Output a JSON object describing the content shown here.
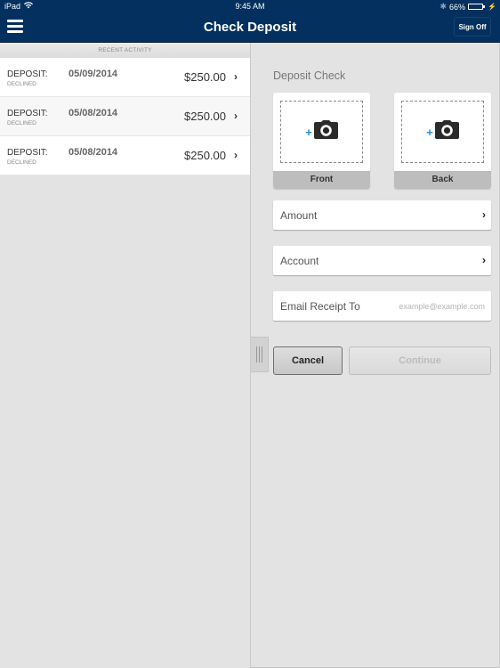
{
  "status_bar": {
    "device": "iPad",
    "time": "9:45 AM",
    "battery_percent": "66%",
    "battery_level": 0.66
  },
  "navbar": {
    "title": "Check Deposit",
    "sign_off_label": "Sign Off"
  },
  "recent_activity": {
    "header": "RECENT ACTIVITY",
    "items": [
      {
        "type": "DEPOSIT:",
        "status": "DECLINED",
        "date": "05/09/2014",
        "amount": "$250.00"
      },
      {
        "type": "DEPOSIT:",
        "status": "DECLINED",
        "date": "05/08/2014",
        "amount": "$250.00"
      },
      {
        "type": "DEPOSIT:",
        "status": "DECLINED",
        "date": "05/08/2014",
        "amount": "$250.00"
      }
    ]
  },
  "deposit_form": {
    "title": "Deposit Check",
    "front_label": "Front",
    "back_label": "Back",
    "amount_label": "Amount",
    "account_label": "Account",
    "email_label": "Email Receipt To",
    "email_placeholder": "example@example.com",
    "email_value": "",
    "cancel_label": "Cancel",
    "continue_label": "Continue"
  },
  "colors": {
    "navbar_bg": "#03305f",
    "plus_accent": "#2a8cd8",
    "battery_fill": "#4cd964"
  }
}
